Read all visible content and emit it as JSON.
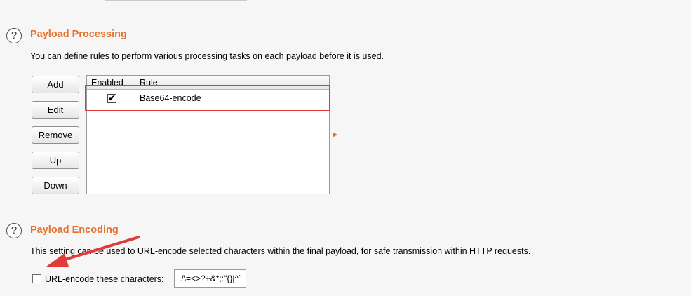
{
  "payload_processing": {
    "title": "Payload Processing",
    "description": "You can define rules to perform various processing tasks on each payload before it is used.",
    "buttons": {
      "add": "Add",
      "edit": "Edit",
      "remove": "Remove",
      "up": "Up",
      "down": "Down"
    },
    "table": {
      "columns": [
        "Enabled",
        "Rule"
      ],
      "rows": [
        {
          "enabled": true,
          "rule": "Base64-encode"
        }
      ]
    }
  },
  "payload_encoding": {
    "title": "Payload Encoding",
    "description": "This setting can be used to URL-encode selected characters within the final payload, for safe transmission within HTTP requests.",
    "checkbox_label": "URL-encode these characters:",
    "checkbox_checked": false,
    "characters_value": "./\\=<>?+&*;:\"{}|^`"
  },
  "icons": {
    "help": "?",
    "check": "✔"
  },
  "colors": {
    "accent": "#e8702a",
    "annotation": "#e03a3a"
  }
}
